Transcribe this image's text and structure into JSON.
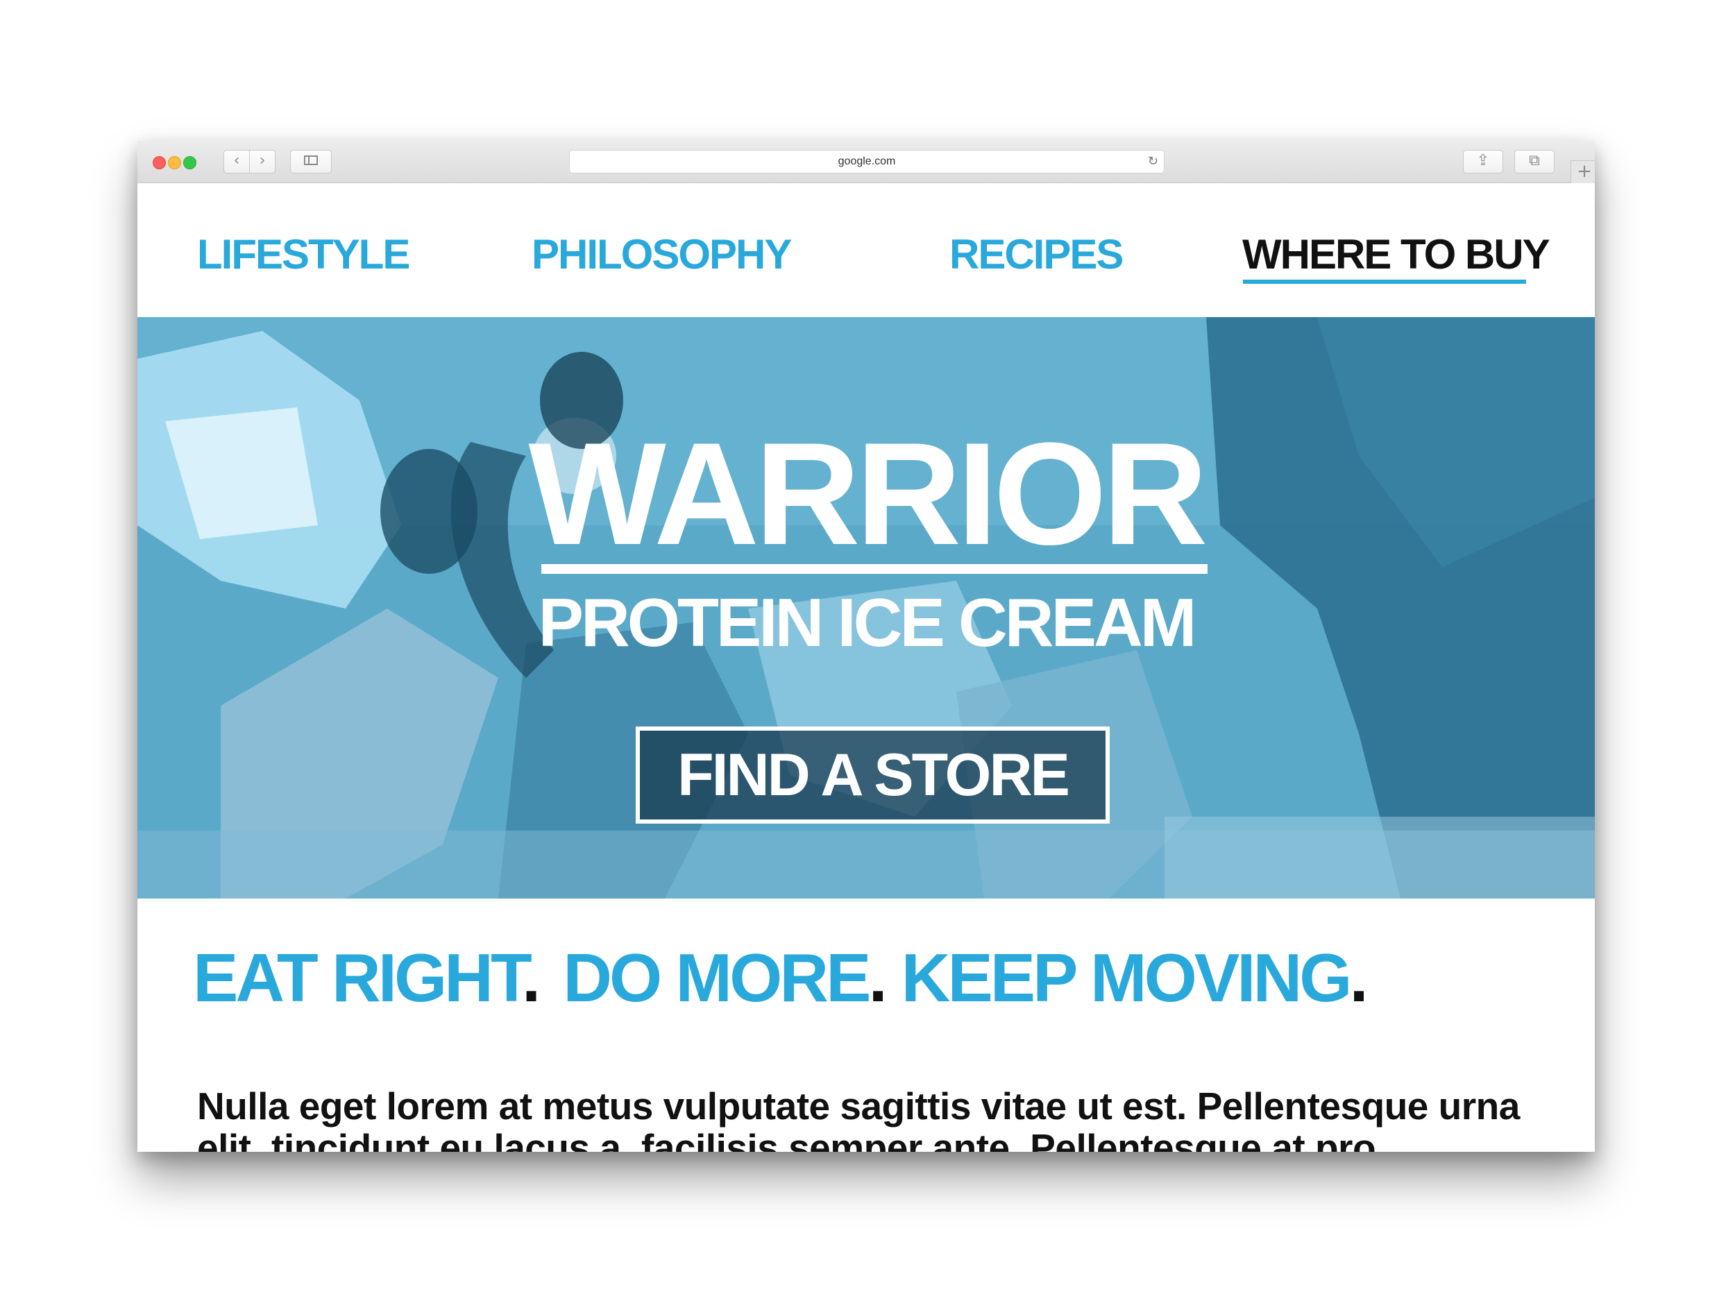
{
  "browser": {
    "address": "google.com",
    "icons": {
      "back": "chevron-left-icon",
      "forward": "chevron-right-icon",
      "sidebar": "sidebar-icon",
      "reload": "reload-icon",
      "share": "share-icon",
      "tabs": "tabs-icon",
      "new_tab": "plus-icon"
    },
    "glyphs": {
      "back": "‹",
      "forward": "›",
      "reload": "↻",
      "share": "⇪",
      "tabs": "⧉",
      "new_tab": "+"
    }
  },
  "nav": {
    "items": [
      {
        "label": "LIFESTYLE"
      },
      {
        "label": "PHILOSOPHY"
      },
      {
        "label": "RECIPES"
      },
      {
        "label": "WHERE TO BUY",
        "active": true
      }
    ]
  },
  "hero": {
    "title": "WARRIOR",
    "subtitle": "PROTEIN ICE CREAM",
    "cta": "FIND A STORE"
  },
  "tagline": {
    "parts": [
      "EAT RIGHT",
      "DO MORE",
      "KEEP MOVING"
    ],
    "separator": "."
  },
  "body": {
    "text": "Nulla eget lorem at metus vulputate sagittis vitae ut est. Pellentesque urna elit, tincidunt eu lacus a, facilisis semper ante. Pellentesque at pro"
  },
  "colors": {
    "accent": "#29a8dc",
    "text": "#111111",
    "hero_tint": "#4c9ec0"
  }
}
